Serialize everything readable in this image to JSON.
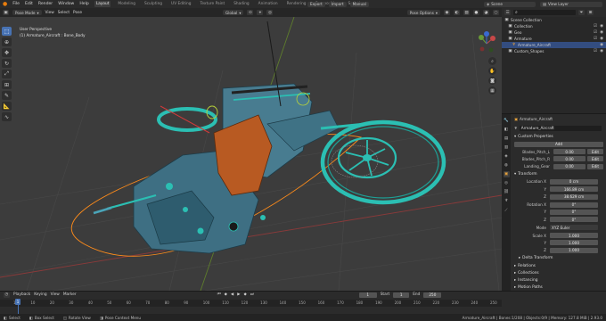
{
  "top_menu": {
    "items": [
      "File",
      "Edit",
      "Render",
      "Window",
      "Help"
    ],
    "workspaces": [
      "Layout",
      "Modeling",
      "Sculpting",
      "UV Editing",
      "Texture Paint",
      "Shading",
      "Animation",
      "Rendering",
      "Compositing",
      "Scripting"
    ],
    "active_workspace": "Layout",
    "actions": [
      "Export",
      "Import",
      "Manual"
    ],
    "scene_label": "Scene",
    "view_layer_label": "View Layer"
  },
  "viewport_header": {
    "mode": "Pose Mode",
    "menus": [
      "View",
      "Select",
      "Pose"
    ],
    "orientation": "Global",
    "options": "Pose Options"
  },
  "viewport_overlay": {
    "line1": "User Perspective",
    "line2": "(1) Armature_Aircraft : Bone_Body"
  },
  "outliner": {
    "rows": [
      {
        "label": "Scene Collection",
        "icon": "collection-icon",
        "indent": 0,
        "selected": false
      },
      {
        "label": "Collection",
        "icon": "collection-icon",
        "indent": 1,
        "selected": false
      },
      {
        "label": "Geo",
        "icon": "collection-icon",
        "indent": 1,
        "selected": false
      },
      {
        "label": "Armature",
        "icon": "collection-icon",
        "indent": 1,
        "selected": false
      },
      {
        "label": "Armature_Aircraft",
        "icon": "armature-icon",
        "indent": 2,
        "selected": true
      },
      {
        "label": "Custom_Shapes",
        "icon": "collection-icon",
        "indent": 1,
        "selected": false
      }
    ]
  },
  "properties": {
    "object_name": "Armature_Aircraft",
    "data_name": "Armature_Aircraft",
    "custom_props_title": "Custom Properties",
    "add_label": "Add",
    "custom_props": [
      {
        "label": "Blades_Pitch_L",
        "value": "0.00"
      },
      {
        "label": "Blades_Pitch_R",
        "value": "0.00"
      },
      {
        "label": "Landing_Gear",
        "value": "0.00"
      }
    ],
    "edit_label": "Edit",
    "transform_title": "Transform",
    "location": {
      "label": "Location X",
      "x": "0 cm",
      "y_label": "Y",
      "y": "166.89 cm",
      "z_label": "Z",
      "z": "38.629 cm"
    },
    "rotation": {
      "label": "Rotation X",
      "x": "0°",
      "y_label": "Y",
      "y": "0°",
      "z_label": "Z",
      "z": "0°"
    },
    "mode": {
      "label": "Mode",
      "value": "XYZ Euler"
    },
    "scale": {
      "label": "Scale X",
      "x": "1.000",
      "y_label": "Y",
      "y": "1.000",
      "z_label": "Z",
      "z": "1.000"
    },
    "sections": [
      "Delta Transform",
      "Relations",
      "Collections",
      "Instancing",
      "Motion Paths",
      "Visibility"
    ]
  },
  "timeline": {
    "menus": [
      "Playback",
      "Keying",
      "View",
      "Marker"
    ],
    "current_frame": "1",
    "start_label": "Start",
    "start": "1",
    "end_label": "End",
    "end": "250",
    "ticks": [
      "1",
      "10",
      "20",
      "30",
      "40",
      "50",
      "60",
      "70",
      "80",
      "90",
      "100",
      "110",
      "120",
      "130",
      "140",
      "150",
      "160",
      "170",
      "180",
      "190",
      "200",
      "210",
      "220",
      "230",
      "240",
      "250"
    ]
  },
  "status_bar": {
    "left": [
      "Select",
      "Box Select",
      "Rotate View",
      "Pose Context Menu"
    ],
    "right": "Armature_Aircraft | Bones:1/208 | Objects:0/9 | Memory: 127.8 MiB | 2.93.0"
  },
  "colors": {
    "accent_blue": "#4772b3",
    "selection_orange": "#ff8c1a",
    "model_teal": "#2bbfb3",
    "viewport_bg": "#3c3c3c"
  }
}
